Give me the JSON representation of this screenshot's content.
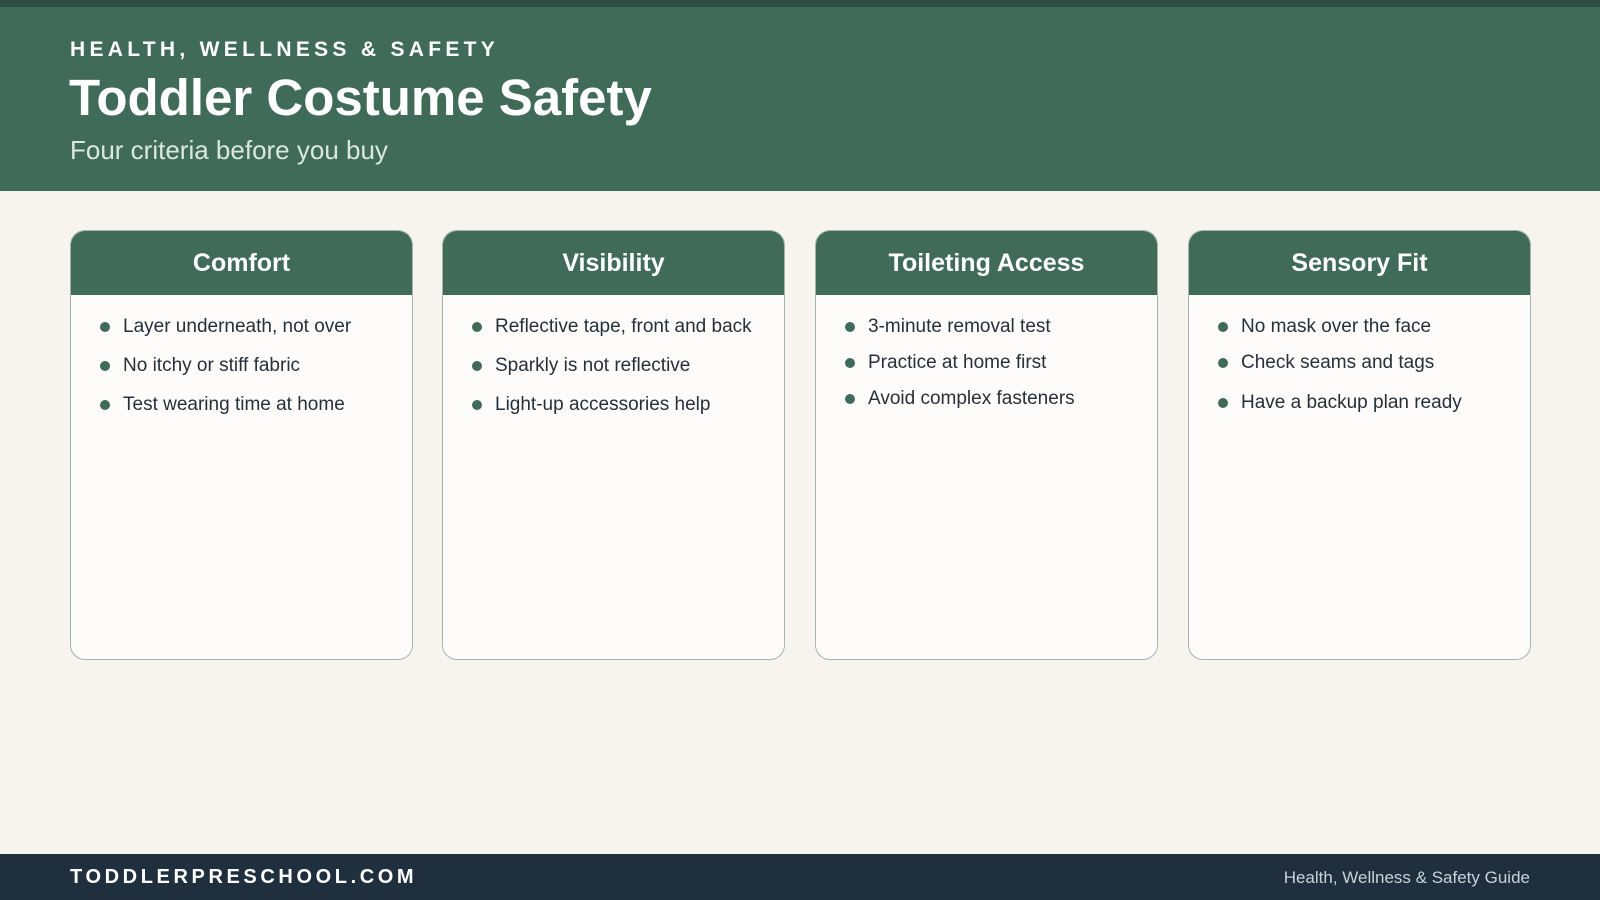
{
  "header": {
    "eyebrow": "HEALTH, WELLNESS & SAFETY",
    "title": "Toddler Costume Safety",
    "subtitle": "Four criteria before you buy"
  },
  "cards": [
    {
      "title": "Comfort",
      "items": [
        "Layer underneath, not over",
        "No itchy or stiff fabric",
        "Test wearing time at home"
      ]
    },
    {
      "title": "Visibility",
      "items": [
        "Reflective tape, front and back",
        "Sparkly is not reflective",
        "Light-up accessories help"
      ]
    },
    {
      "title": "Toileting Access",
      "items": [
        "3-minute removal test",
        "Practice at home first",
        "Avoid complex fasteners"
      ]
    },
    {
      "title": "Sensory Fit",
      "items": [
        "No mask over the face",
        "Check seams and tags",
        "Have a backup plan ready"
      ]
    }
  ],
  "footer": {
    "brand": "TODDLERPRESCHOOL.COM",
    "guide": "Health, Wellness & Safety Guide"
  },
  "colors": {
    "header_green": "#3f6b58",
    "background": "#f7f3ee",
    "footer_navy": "#1f2f3d"
  },
  "icons": {
    "bullet": "filled-circle-bullet-icon"
  }
}
